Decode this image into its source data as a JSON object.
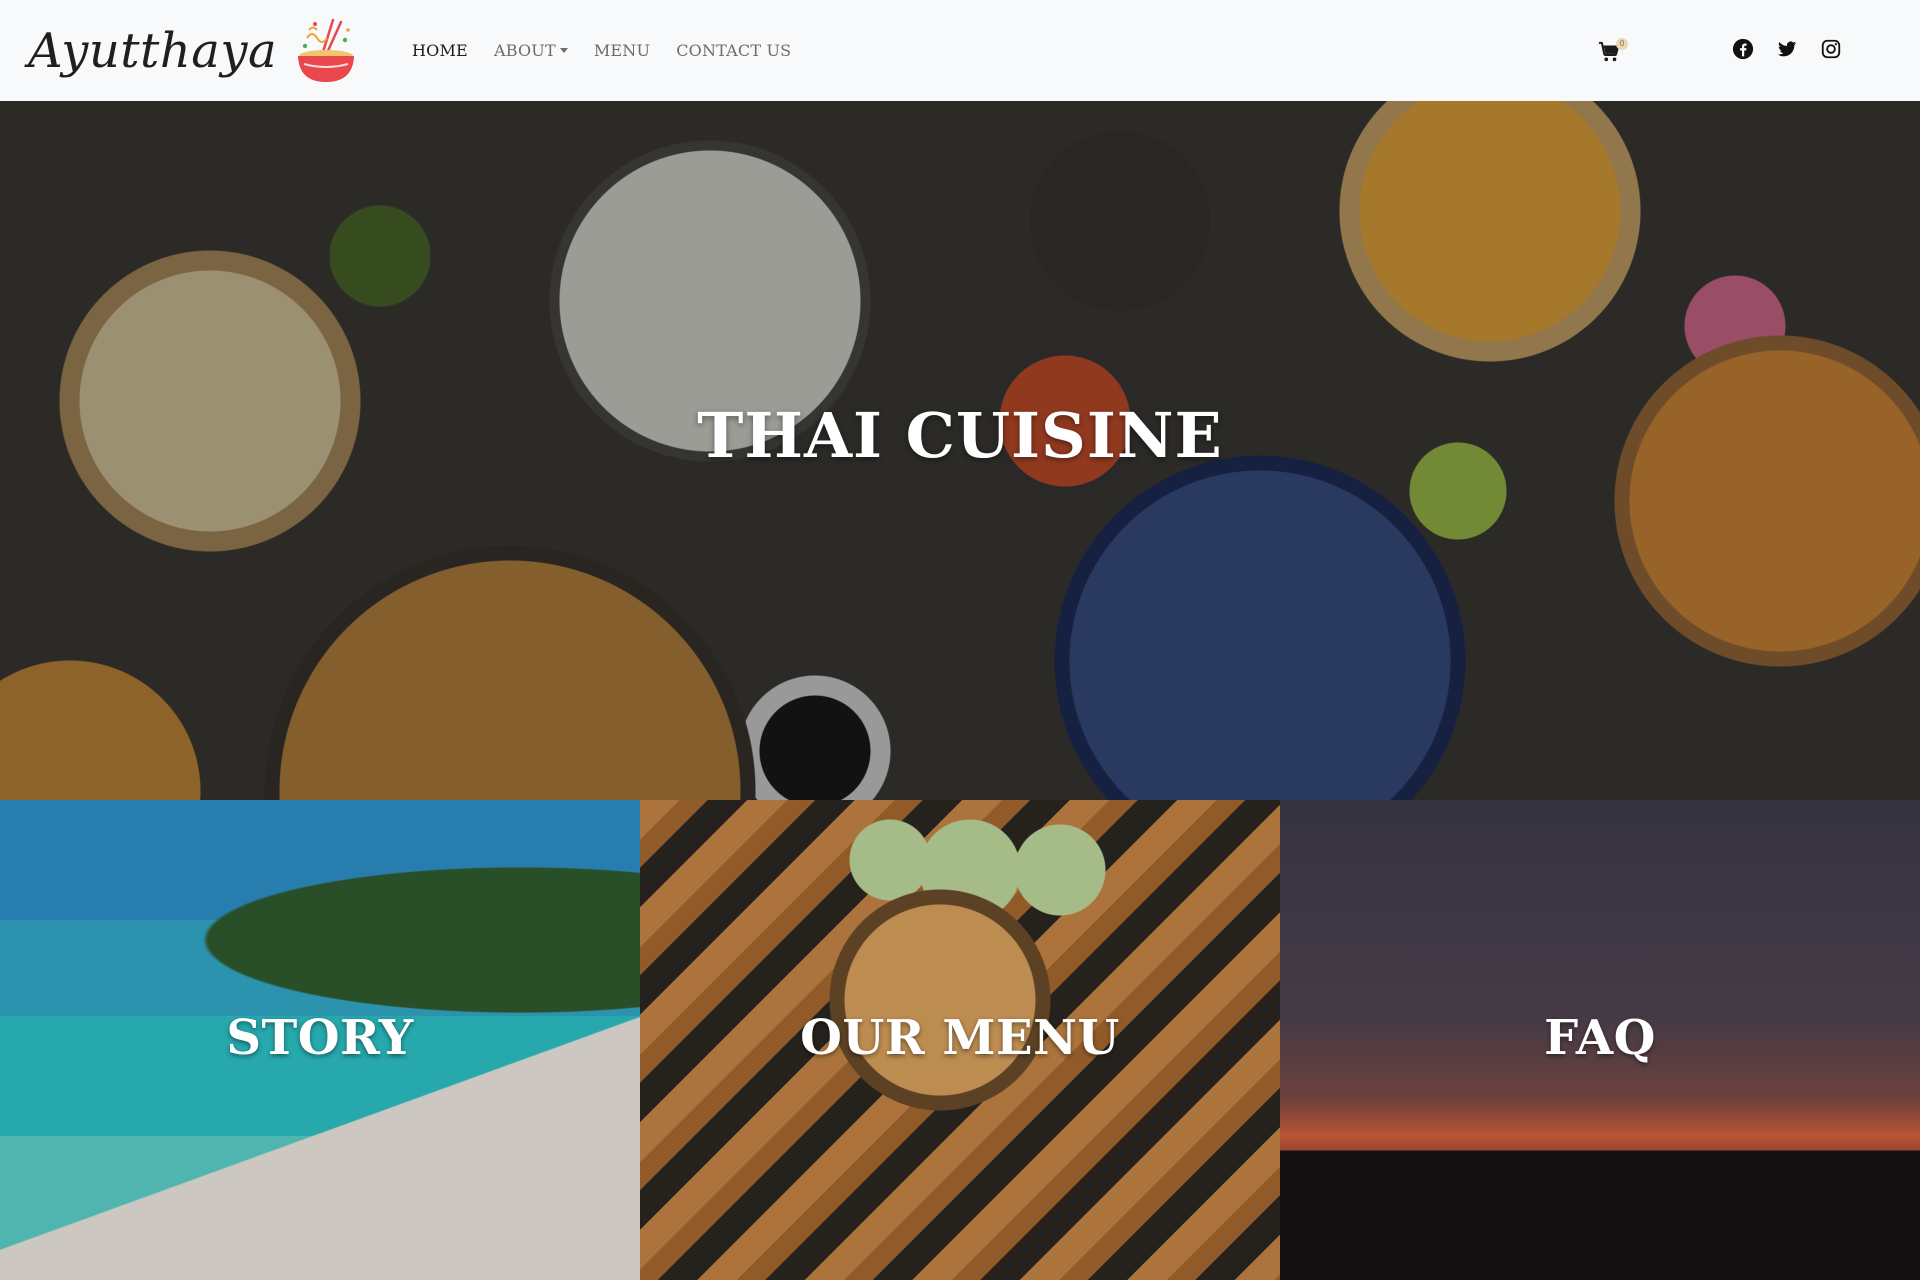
{
  "brand": {
    "name": "Ayutthaya",
    "logo_icon": "noodle-bowl-icon"
  },
  "nav": {
    "items": [
      {
        "label": "HOME",
        "active": true
      },
      {
        "label": "ABOUT",
        "dropdown": true
      },
      {
        "label": "MENU"
      },
      {
        "label": "CONTACT US"
      }
    ]
  },
  "cart": {
    "icon": "cart-icon",
    "count": "0"
  },
  "socials": [
    {
      "icon": "facebook-icon"
    },
    {
      "icon": "twitter-icon"
    },
    {
      "icon": "instagram-icon"
    }
  ],
  "hero": {
    "title": "THAI CUISINE"
  },
  "tiles": [
    {
      "title": "STORY"
    },
    {
      "title": "OUR MENU"
    },
    {
      "title": "FAQ"
    }
  ],
  "colors": {
    "navbar_bg": "#f8f9fa",
    "nav_active": "#1b1b1b",
    "nav_inactive": "#6c6c6c",
    "logo_accent": "#e8474c"
  }
}
